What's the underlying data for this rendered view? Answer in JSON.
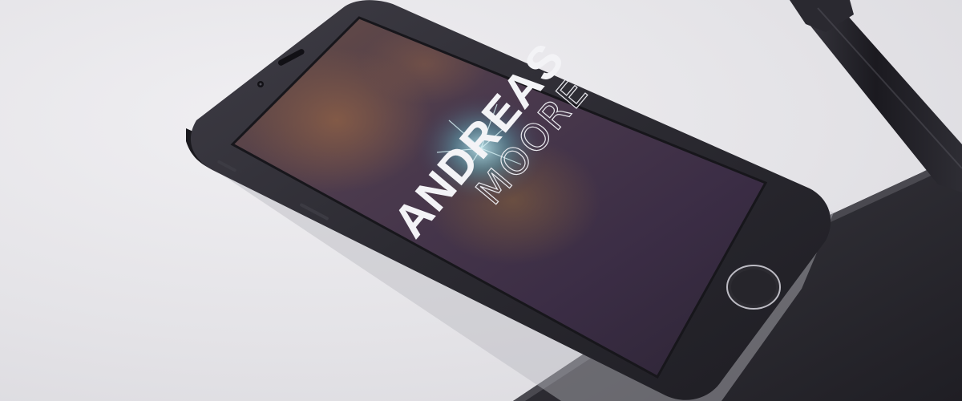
{
  "screen": {
    "title_line_1": "ANDREAS",
    "title_line_2": "MOORE"
  },
  "colors": {
    "surface": "#e6e5e9",
    "notebook": "#2c2b31",
    "phone_body": "#2a2930",
    "screen_tint": "#3b2d45",
    "pen": "#24232a"
  },
  "icons": [
    "home-button-icon",
    "front-camera-icon",
    "earpiece-icon",
    "pen-icon"
  ]
}
